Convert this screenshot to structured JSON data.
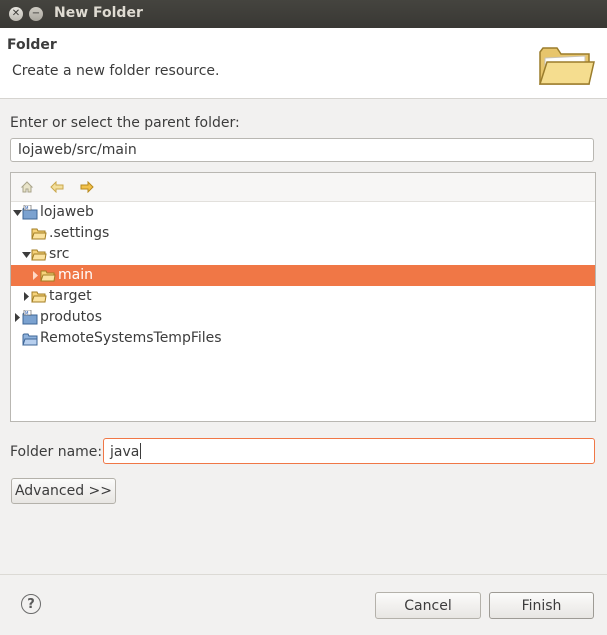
{
  "window": {
    "title": "New Folder",
    "controls": [
      "close-icon",
      "minimize-icon"
    ]
  },
  "header": {
    "title": "Folder",
    "description": "Create a new folder resource.",
    "icon": "folder-large-icon"
  },
  "parent": {
    "label": "Enter or select the parent folder:",
    "value": "lojaweb/src/main"
  },
  "toolbar": {
    "icons": [
      "home-icon",
      "back-arrow-icon",
      "forward-arrow-icon"
    ]
  },
  "tree": {
    "items": [
      {
        "label": "lojaweb",
        "icon": "project-icon",
        "expanded": true
      },
      {
        "label": ".settings",
        "icon": "folder-icon"
      },
      {
        "label": "src",
        "icon": "folder-open-icon",
        "expanded": true
      },
      {
        "label": "main",
        "icon": "folder-icon",
        "selected": true
      },
      {
        "label": "target",
        "icon": "folder-icon",
        "expanded": false
      },
      {
        "label": "produtos",
        "icon": "project-icon",
        "expanded": false
      },
      {
        "label": "RemoteSystemsTempFiles",
        "icon": "project-closed-icon"
      }
    ]
  },
  "folder_name": {
    "label": "Folder name:",
    "value": "java"
  },
  "buttons": {
    "advanced": "Advanced >>",
    "cancel": "Cancel",
    "finish": "Finish"
  },
  "colors": {
    "selection": "#f07746",
    "titlebar": "#3c3b37",
    "focus_border": "#f07746"
  }
}
